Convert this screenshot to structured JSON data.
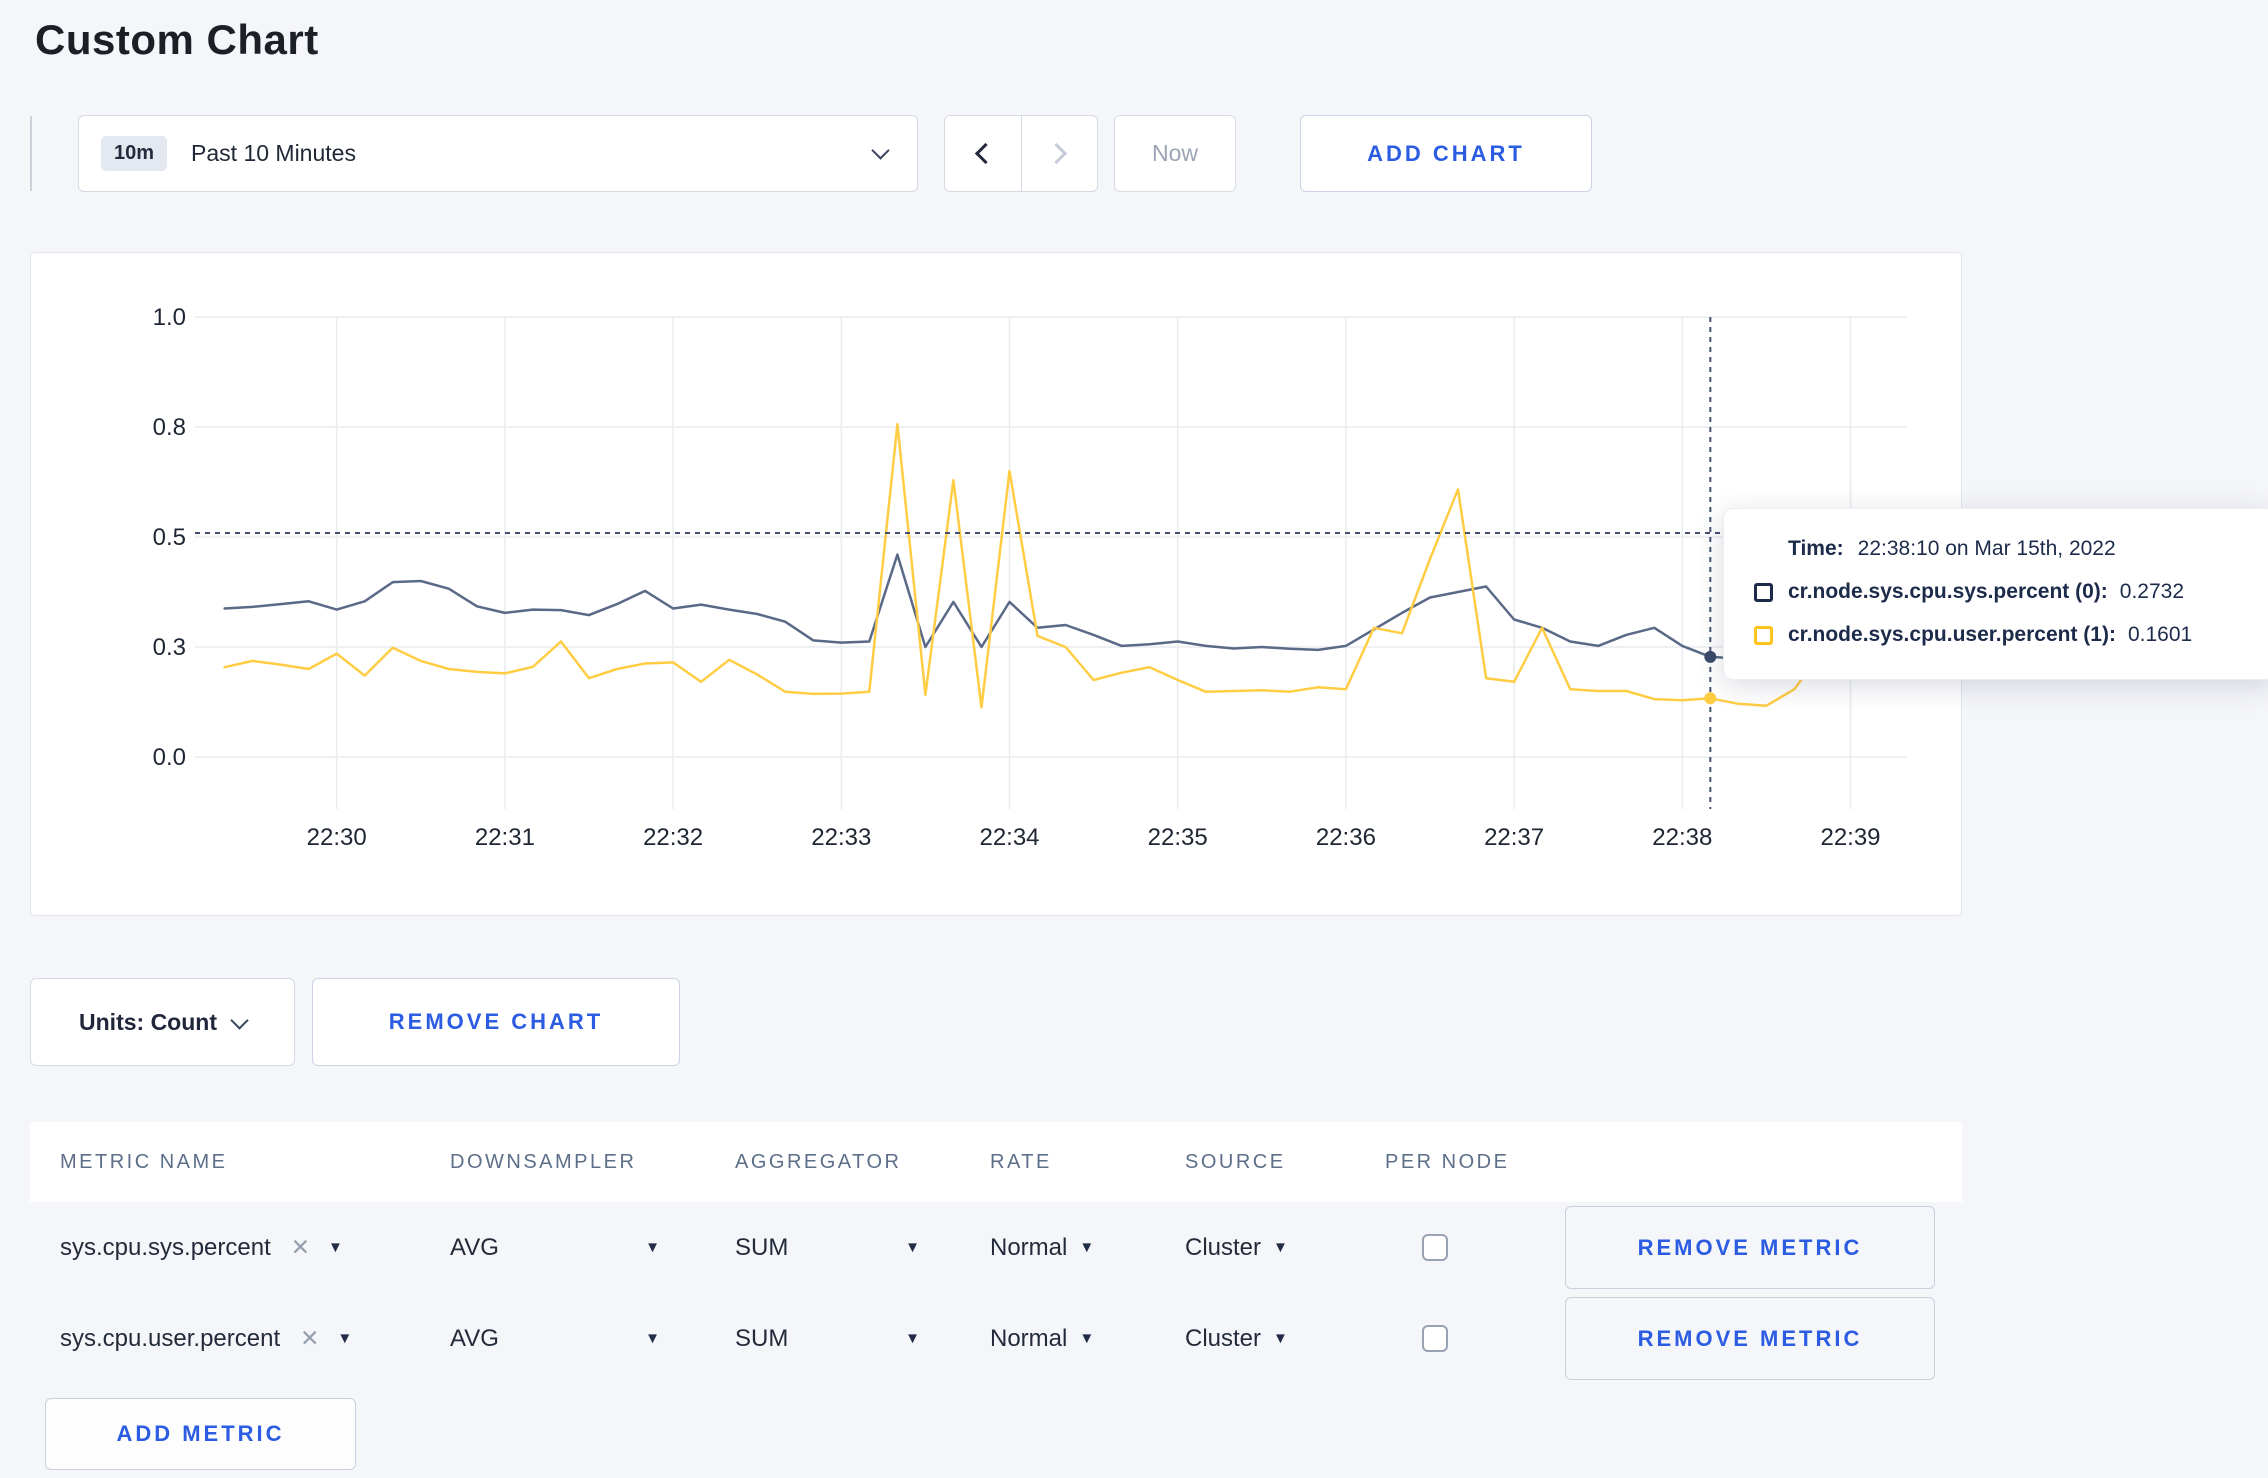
{
  "page": {
    "title": "Custom Chart",
    "background": "#f5f6fa",
    "accent_blue": "#2b5ce2"
  },
  "toolbar": {
    "time_range": {
      "badge": "10m",
      "label": "Past 10 Minutes"
    },
    "now_label": "Now",
    "add_chart_label": "ADD CHART"
  },
  "icons": {
    "caret_down": "▼",
    "remove_x": "✕"
  },
  "chart_data": {
    "type": "line",
    "title": "",
    "xlabel": "",
    "ylabel": "",
    "y_ticks": {
      "values": [
        0.0,
        0.3,
        0.5,
        0.8,
        1.0
      ],
      "labels": [
        "0.0",
        "0.3",
        "0.5",
        "0.8",
        "1.0"
      ]
    },
    "x_ticks": [
      "22:30",
      "22:31",
      "22:32",
      "22:33",
      "22:34",
      "22:35",
      "22:36",
      "22:37",
      "22:38",
      "22:39"
    ],
    "start_offset_sec": -40,
    "step_sec": 10,
    "grid": true,
    "legend_position": "tooltip",
    "series": [
      {
        "name": "cr.node.sys.cpu.sys.percent (0)",
        "color": "#5a6987",
        "values": [
          0.37,
          0.373,
          0.378,
          0.383,
          0.368,
          0.383,
          0.418,
          0.42,
          0.406,
          0.374,
          0.362,
          0.368,
          0.367,
          0.358,
          0.378,
          0.402,
          0.37,
          0.377,
          0.368,
          0.36,
          0.346,
          0.312,
          0.308,
          0.31,
          0.468,
          0.3,
          0.382,
          0.3,
          0.382,
          0.335,
          0.34,
          0.322,
          0.302,
          0.305,
          0.31,
          0.302,
          0.296,
          0.3,
          0.295,
          0.292,
          0.302,
          0.332,
          0.362,
          0.39,
          0.4,
          0.41,
          0.35,
          0.335,
          0.31,
          0.302,
          0.322,
          0.335,
          0.302,
          0.2732,
          0.268,
          0.285,
          0.295,
          0.3,
          0.302,
          0.298,
          0.3,
          0.304
        ]
      },
      {
        "name": "cr.node.sys.cpu.user.percent (1)",
        "color": "#ffcd44",
        "values": [
          0.245,
          0.262,
          0.252,
          0.24,
          0.282,
          0.222,
          0.298,
          0.262,
          0.24,
          0.232,
          0.228,
          0.246,
          0.31,
          0.215,
          0.24,
          0.255,
          0.258,
          0.205,
          0.265,
          0.225,
          0.178,
          0.172,
          0.173,
          0.178,
          0.805,
          0.17,
          0.655,
          0.135,
          0.68,
          0.32,
          0.3,
          0.21,
          0.23,
          0.245,
          0.21,
          0.178,
          0.18,
          0.182,
          0.178,
          0.19,
          0.185,
          0.335,
          0.325,
          0.46,
          0.63,
          0.215,
          0.205,
          0.335,
          0.185,
          0.18,
          0.18,
          0.158,
          0.155,
          0.1601,
          0.145,
          0.14,
          0.185,
          0.29,
          0.29,
          0.235,
          0.27,
          0.272
        ]
      }
    ],
    "crosshair": {
      "t_sec": 490,
      "hline_value": 0.511,
      "dots": [
        {
          "value": 0.2732,
          "color": "#3a4a68"
        },
        {
          "value": 0.1601,
          "color": "#ffcd44"
        }
      ]
    },
    "tooltip": {
      "time_label": "Time:",
      "time_value": "22:38:10 on Mar 15th, 2022",
      "rows": [
        {
          "name": "cr.node.sys.cpu.sys.percent (0):",
          "value": "0.2732",
          "swatch": "#1c2b4a"
        },
        {
          "name": "cr.node.sys.cpu.user.percent (1):",
          "value": "0.1601",
          "swatch": "#ffc41c"
        }
      ]
    }
  },
  "units_bar": {
    "units_label": "Units: Count",
    "remove_chart_label": "REMOVE CHART"
  },
  "metrics_table": {
    "headers": [
      "METRIC NAME",
      "DOWNSAMPLER",
      "AGGREGATOR",
      "RATE",
      "SOURCE",
      "PER NODE"
    ],
    "rows": [
      {
        "metric": "sys.cpu.sys.percent",
        "downsampler": "AVG",
        "aggregator": "SUM",
        "rate": "Normal",
        "source": "Cluster",
        "per_node_checked": false,
        "remove_label": "REMOVE METRIC"
      },
      {
        "metric": "sys.cpu.user.percent",
        "downsampler": "AVG",
        "aggregator": "SUM",
        "rate": "Normal",
        "source": "Cluster",
        "per_node_checked": false,
        "remove_label": "REMOVE METRIC"
      }
    ],
    "add_metric_label": "ADD METRIC"
  }
}
